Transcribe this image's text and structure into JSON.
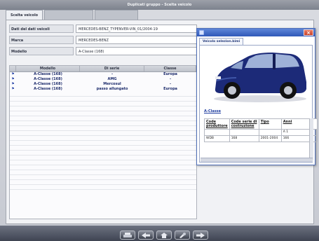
{
  "window": {
    "title": "Duplicati gruppo - Scelta veicolo"
  },
  "tabs": [
    {
      "label": "Scelta veicolo",
      "active": true
    },
    {
      "label": "",
      "active": false
    },
    {
      "label": "",
      "active": false
    }
  ],
  "fields": [
    {
      "label": "Dati del dati veicoli",
      "value": "MERCEDES-BENZ_TYPENVER-VIN_01/2004-19"
    },
    {
      "label": "Marca",
      "value": "MERCEDES-BENZ"
    },
    {
      "label": "Modello",
      "value": "A-Classe (168)"
    }
  ],
  "grid": {
    "columns": [
      "Modello",
      "Di serie",
      "Classe"
    ],
    "rows": [
      {
        "modello": "A-Classe (168)",
        "serie": "-",
        "classe": "Europa"
      },
      {
        "modello": "A-Classe (168)",
        "serie": "AMG",
        "classe": "-"
      },
      {
        "modello": "A-Classe (168)",
        "serie": "Mercosul",
        "classe": "-"
      },
      {
        "modello": "A-Classe (168)",
        "serie": "passo allungato",
        "classe": "Europa"
      }
    ]
  },
  "popup": {
    "title": "",
    "tab_label": "Veicolo selezion.bimi",
    "car_name": "A-Classe",
    "table": {
      "headers": [
        "Code produttore",
        "Code serie di costruzione",
        "Tipo",
        "Anni"
      ],
      "rows": [
        [
          "",
          "",
          "",
          "A 1"
        ],
        [
          "WDB",
          "168",
          "2001-2004",
          "166 "
        ]
      ]
    }
  },
  "colors": {
    "accent": "#2f58b8",
    "car_body": "#1c2a78",
    "link": "#1f3da0"
  },
  "footer": {
    "buttons": [
      {
        "icon": "print-icon"
      },
      {
        "icon": "back-icon"
      },
      {
        "icon": "home-icon"
      },
      {
        "icon": "tools-icon"
      },
      {
        "icon": "forward-icon"
      }
    ]
  }
}
